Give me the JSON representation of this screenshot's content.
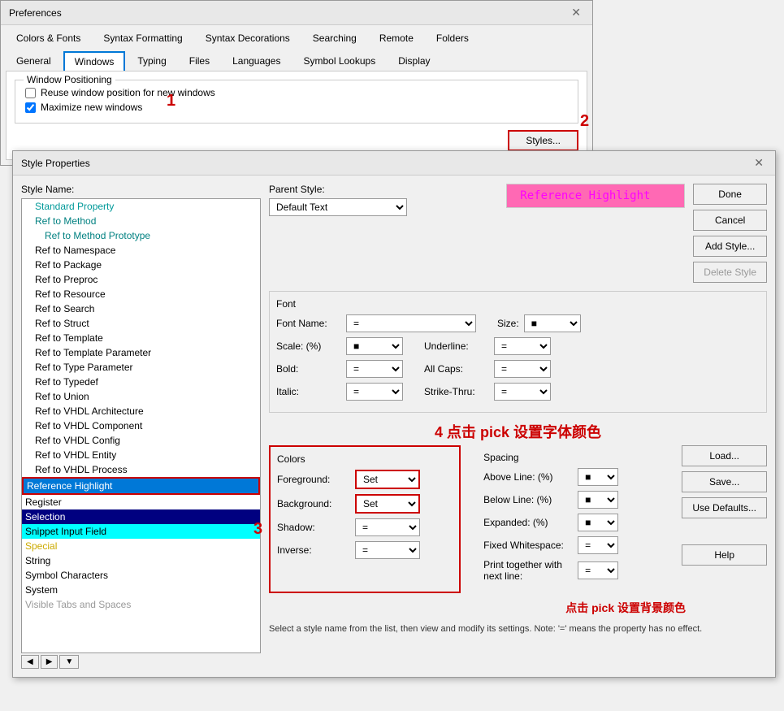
{
  "preferences": {
    "title": "Preferences",
    "tabs_row1": [
      "Colors & Fonts",
      "Syntax Formatting",
      "Syntax Decorations",
      "Searching",
      "Remote",
      "Folders"
    ],
    "tabs_row2": [
      "General",
      "Windows",
      "Typing",
      "Files",
      "Languages",
      "Symbol Lookups",
      "Display"
    ],
    "active_tab": "Windows",
    "window_positioning_label": "Window Positioning",
    "checkbox1_label": "Reuse window position for new windows",
    "checkbox2_label": "Maximize new windows",
    "checkbox1_checked": false,
    "checkbox2_checked": true,
    "styles_button": "Styles...",
    "step1": "1",
    "step2": "2"
  },
  "style_properties": {
    "title": "Style Properties",
    "style_name_label": "Style Name:",
    "parent_style_label": "Parent Style:",
    "parent_style_value": "Default Text",
    "preview_text": "Reference Highlight",
    "font_section_title": "Font",
    "font_name_label": "Font Name:",
    "font_name_value": "=",
    "size_label": "Size:",
    "size_value": "■",
    "scale_label": "Scale: (%)",
    "scale_value": "■",
    "underline_label": "Underline:",
    "underline_value": "=",
    "bold_label": "Bold:",
    "bold_value": "=",
    "all_caps_label": "All Caps:",
    "all_caps_value": "=",
    "italic_label": "Italic:",
    "italic_value": "=",
    "strikethru_label": "Strike-Thru:",
    "strikethru_value": "=",
    "colors_title": "Colors",
    "foreground_label": "Foreground:",
    "foreground_value": "Set",
    "background_label": "Background:",
    "background_value": "Set",
    "shadow_label": "Shadow:",
    "shadow_value": "=",
    "inverse_label": "Inverse:",
    "inverse_value": "=",
    "spacing_title": "Spacing",
    "above_line_label": "Above Line: (%)",
    "above_line_value": "■",
    "below_line_label": "Below Line: (%)",
    "below_line_value": "■",
    "expanded_label": "Expanded: (%)",
    "expanded_value": "■",
    "fixed_whitespace_label": "Fixed Whitespace:",
    "fixed_whitespace_value": "=",
    "print_together_label": "Print together with next line:",
    "print_together_value": "=",
    "done_button": "Done",
    "cancel_button": "Cancel",
    "add_style_button": "Add Style...",
    "delete_style_button": "Delete Style",
    "load_button": "Load...",
    "save_button": "Save...",
    "use_defaults_button": "Use Defaults...",
    "help_button": "Help",
    "note_text": "Select a style name from the list, then view and modify its settings. Note: '=' means the property has no effect.",
    "step3": "3",
    "step4": "4  点击 pick 设置字体颜色",
    "step4b": "点击 pick 设置背景颜色",
    "style_list": [
      {
        "label": "Standard Property",
        "indent": 1,
        "color": "cyan"
      },
      {
        "label": "Ref to Method",
        "indent": 1,
        "color": "teal"
      },
      {
        "label": "Ref to Method Prototype",
        "indent": 2,
        "color": "teal"
      },
      {
        "label": "Ref to Namespace",
        "indent": 1,
        "color": "normal"
      },
      {
        "label": "Ref to Package",
        "indent": 1,
        "color": "normal"
      },
      {
        "label": "Ref to Preproc",
        "indent": 1,
        "color": "normal"
      },
      {
        "label": "Ref to Resource",
        "indent": 1,
        "color": "normal"
      },
      {
        "label": "Ref to Search",
        "indent": 1,
        "color": "normal"
      },
      {
        "label": "Ref to Struct",
        "indent": 1,
        "color": "normal"
      },
      {
        "label": "Ref to Template",
        "indent": 1,
        "color": "normal"
      },
      {
        "label": "Ref to Template Parameter",
        "indent": 1,
        "color": "normal"
      },
      {
        "label": "Ref to Type Parameter",
        "indent": 1,
        "color": "normal"
      },
      {
        "label": "Ref to Typedef",
        "indent": 1,
        "color": "normal"
      },
      {
        "label": "Ref to Union",
        "indent": 1,
        "color": "normal"
      },
      {
        "label": "Ref to VHDL Architecture",
        "indent": 1,
        "color": "normal"
      },
      {
        "label": "Ref to VHDL Component",
        "indent": 1,
        "color": "normal"
      },
      {
        "label": "Ref to VHDL Config",
        "indent": 1,
        "color": "normal"
      },
      {
        "label": "Ref to VHDL Entity",
        "indent": 1,
        "color": "normal"
      },
      {
        "label": "Ref to VHDL Process",
        "indent": 1,
        "color": "normal"
      },
      {
        "label": "Reference Highlight",
        "indent": 0,
        "color": "selected-hl"
      },
      {
        "label": "Register",
        "indent": 0,
        "color": "normal"
      },
      {
        "label": "Selection",
        "indent": 0,
        "color": "navy"
      },
      {
        "label": "Snippet Input Field",
        "indent": 0,
        "color": "cyan-bg"
      },
      {
        "label": "Special",
        "indent": 0,
        "color": "yellow-text"
      },
      {
        "label": "String",
        "indent": 0,
        "color": "normal"
      },
      {
        "label": "Symbol Characters",
        "indent": 0,
        "color": "normal"
      },
      {
        "label": "System",
        "indent": 0,
        "color": "normal"
      },
      {
        "label": "Visible Tabs and Spaces",
        "indent": 0,
        "color": "gray"
      }
    ]
  }
}
